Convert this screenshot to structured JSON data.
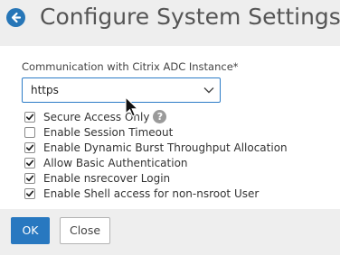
{
  "header": {
    "title": "Configure System Settings",
    "back_icon": "back-arrow-icon"
  },
  "form": {
    "communication_label": "Communication with Citrix ADC Instance*",
    "communication_value": "https",
    "checkboxes": [
      {
        "label": "Secure Access Only",
        "checked": true,
        "has_help": true
      },
      {
        "label": "Enable Session Timeout",
        "checked": false,
        "has_help": false
      },
      {
        "label": "Enable Dynamic Burst Throughput Allocation",
        "checked": true,
        "has_help": false
      },
      {
        "label": "Allow Basic Authentication",
        "checked": true,
        "has_help": false
      },
      {
        "label": "Enable nsrecover Login",
        "checked": true,
        "has_help": false
      },
      {
        "label": "Enable Shell access for non-nsroot User",
        "checked": true,
        "has_help": false
      }
    ],
    "help_glyph": "?"
  },
  "footer": {
    "ok_label": "OK",
    "close_label": "Close"
  },
  "colors": {
    "accent": "#2776b7",
    "background": "#eeeeee",
    "panel": "#ffffff"
  }
}
